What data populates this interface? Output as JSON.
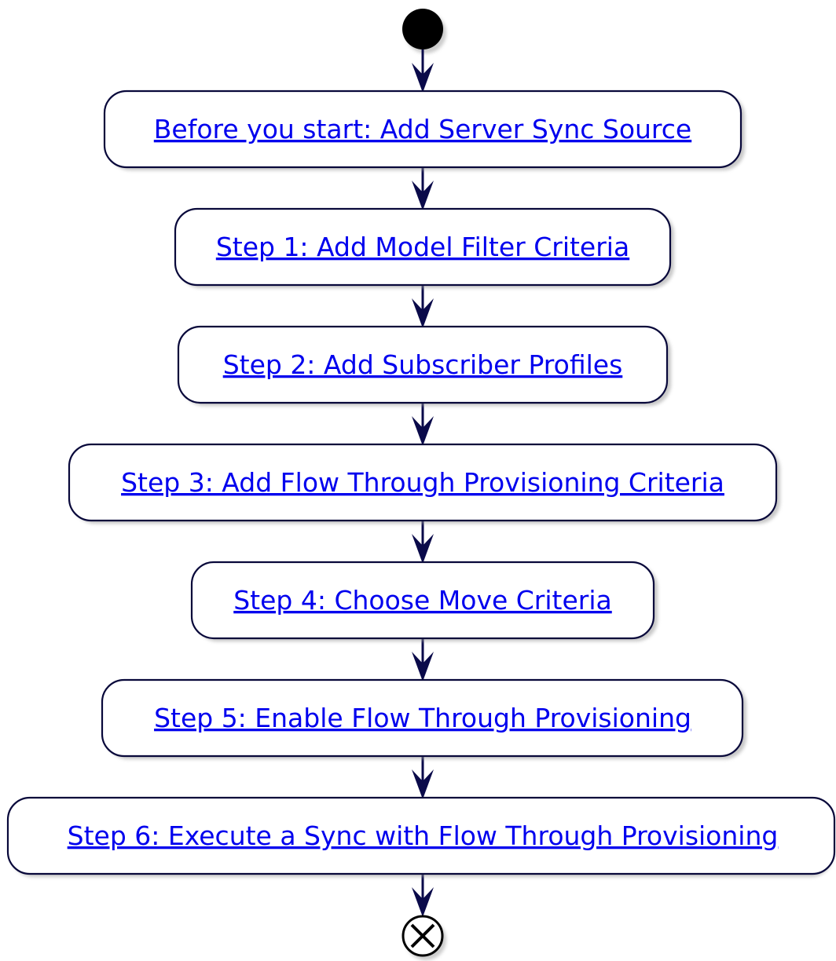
{
  "diagram": {
    "colors": {
      "link": "#0000ee",
      "border": "#08083a",
      "arrow": "#0a0a4a",
      "start_node": "#000000"
    },
    "start_node": {
      "icon": "start-node-filled-circle"
    },
    "end_node": {
      "icon": "end-node-circled-x"
    },
    "steps": [
      {
        "label": "Before you start: Add Server Sync Source"
      },
      {
        "label": "Step 1: Add Model Filter Criteria"
      },
      {
        "label": "Step 2: Add Subscriber Profiles"
      },
      {
        "label": "Step 3: Add Flow Through Provisioning Criteria"
      },
      {
        "label": "Step 4: Choose Move Criteria"
      },
      {
        "label": "Step 5: Enable Flow Through Provisioning"
      },
      {
        "label": "Step 6: Execute a Sync with Flow Through Provisioning"
      }
    ]
  }
}
